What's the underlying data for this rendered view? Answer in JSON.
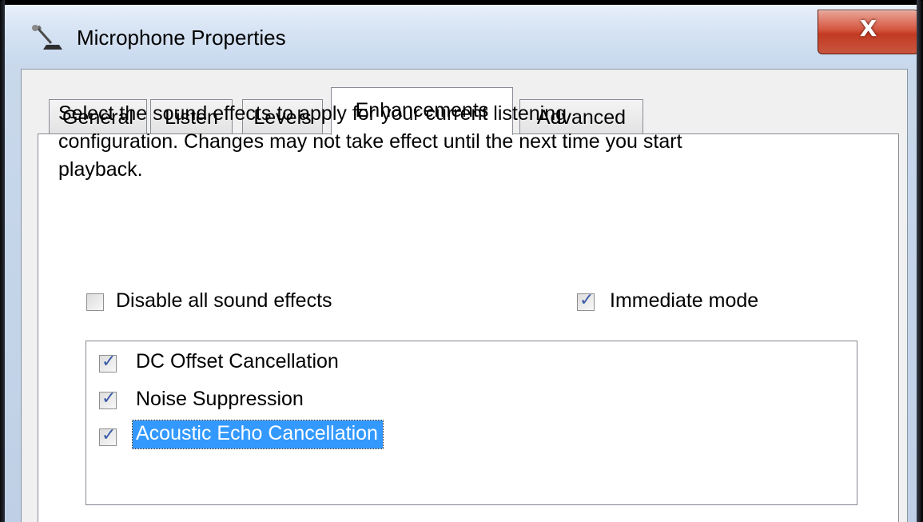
{
  "window": {
    "title": "Microphone Properties",
    "close_label": "X"
  },
  "tabs": [
    {
      "label": "General"
    },
    {
      "label": "Listen"
    },
    {
      "label": "Levels"
    },
    {
      "label": "Enhancements",
      "active": true
    },
    {
      "label": "Advanced"
    }
  ],
  "panel": {
    "description_line1": "Select the sound effects to apply for your current listening",
    "description_line2": "configuration. Changes may not take effect until the next time you start",
    "description_line3": "playback.",
    "disable_all": {
      "label": "Disable all sound effects",
      "checked": false
    },
    "immediate_mode": {
      "label": "Immediate mode",
      "checked": true
    },
    "effects": [
      {
        "label": "DC Offset Cancellation",
        "checked": true,
        "selected": false
      },
      {
        "label": "Noise Suppression",
        "checked": true,
        "selected": false
      },
      {
        "label": "Acoustic Echo Cancellation",
        "checked": true,
        "selected": true
      }
    ]
  },
  "colors": {
    "selection": "#3399ff",
    "close_button": "#c8432b",
    "check_mark": "#3a5aa8"
  },
  "icons": {
    "title_icon": "microphone-icon",
    "close_icon": "close-icon"
  }
}
